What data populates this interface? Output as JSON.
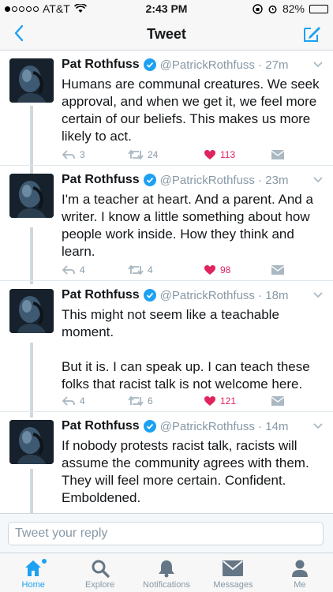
{
  "status_bar": {
    "carrier": "AT&T",
    "time": "2:43 PM",
    "battery": "82%",
    "battery_level": 0.82
  },
  "nav": {
    "title": "Tweet",
    "back_icon": "chevron-left-icon",
    "compose_icon": "compose-icon"
  },
  "colors": {
    "accent": "#1da1f2",
    "like": "#e0245e",
    "secondary_text": "#8899a6"
  },
  "tweets": [
    {
      "name": "Pat Rothfuss",
      "handle": "@PatrickRothfuss",
      "time": "27m",
      "text": "Humans are communal creatures. We seek approval, and when we get it, we feel more certain of our beliefs. This makes us more likely to act.",
      "replies": "3",
      "retweets": "24",
      "likes": "113",
      "liked": true
    },
    {
      "name": "Pat Rothfuss",
      "handle": "@PatrickRothfuss",
      "time": "23m",
      "text": "I'm a teacher at heart. And a parent. And a writer. I know a little something about how people work inside. How they think and learn.",
      "replies": "4",
      "retweets": "4",
      "likes": "98",
      "liked": true
    },
    {
      "name": "Pat Rothfuss",
      "handle": "@PatrickRothfuss",
      "time": "18m",
      "text": "This might not seem like a teachable moment.\n\nBut it is. I can speak up. I can teach these folks that racist talk is not welcome here.",
      "replies": "4",
      "retweets": "6",
      "likes": "121",
      "liked": true
    },
    {
      "name": "Pat Rothfuss",
      "handle": "@PatrickRothfuss",
      "time": "14m",
      "text": "If nobody protests racist talk, racists will assume the community agrees with them. They will feel more certain. Confident. Emboldened.",
      "replies": "",
      "retweets": "",
      "likes": "",
      "liked": false
    }
  ],
  "reply": {
    "placeholder": "Tweet your reply"
  },
  "tabs": [
    {
      "label": "Home",
      "icon": "home-icon",
      "active": true
    },
    {
      "label": "Explore",
      "icon": "search-icon",
      "active": false
    },
    {
      "label": "Notifications",
      "icon": "bell-icon",
      "active": false
    },
    {
      "label": "Messages",
      "icon": "envelope-icon",
      "active": false
    },
    {
      "label": "Me",
      "icon": "person-icon",
      "active": false
    }
  ]
}
